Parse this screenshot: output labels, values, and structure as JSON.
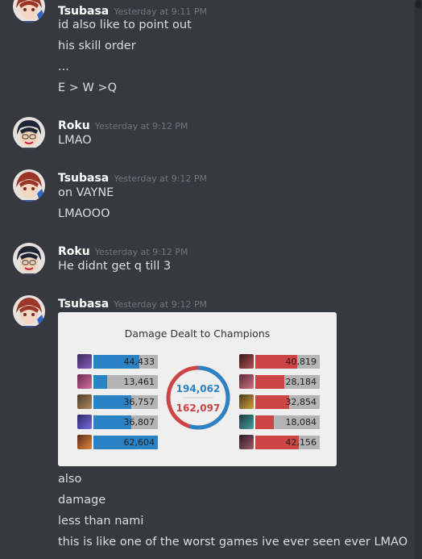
{
  "messages": [
    {
      "author": "Tsubasa",
      "timestamp": "Yesterday at 9:11 PM",
      "lines": [
        "id also like to point out",
        "his skill order",
        "...",
        "E > W >Q"
      ]
    },
    {
      "author": "Roku",
      "timestamp": "Yesterday at 9:12 PM",
      "lines": [
        "LMAO"
      ]
    },
    {
      "author": "Tsubasa",
      "timestamp": "Yesterday at 9:12 PM",
      "lines": [
        "on VAYNE",
        "LMAOOO"
      ]
    },
    {
      "author": "Roku",
      "timestamp": "Yesterday at 9:12 PM",
      "lines": [
        "He didnt get q till 3"
      ]
    },
    {
      "author": "Tsubasa",
      "timestamp": "Yesterday at 9:12 PM",
      "lines": [
        "also",
        "damage",
        "less than nami",
        "this is like one of the worst games ive ever seen ever LMAO"
      ]
    }
  ],
  "attachment": {
    "title": "Damage Dealt to Champions",
    "blue_total": "194,062",
    "red_total": "162,097",
    "blue_team": [
      {
        "value": 44433,
        "label": "44,433"
      },
      {
        "value": 13461,
        "label": "13,461"
      },
      {
        "value": 36757,
        "label": "36,757"
      },
      {
        "value": 36807,
        "label": "36,807"
      },
      {
        "value": 62604,
        "label": "62,604"
      }
    ],
    "red_team": [
      {
        "value": 40819,
        "label": "40,819"
      },
      {
        "value": 28184,
        "label": "28,184"
      },
      {
        "value": 32854,
        "label": "32,854"
      },
      {
        "value": 18084,
        "label": "18,084"
      },
      {
        "value": 42156,
        "label": "42,156"
      }
    ],
    "max_value": 62604,
    "colors": {
      "blue": "#2b82c4",
      "red": "#cc4444",
      "track": "#b4b4b4"
    }
  }
}
